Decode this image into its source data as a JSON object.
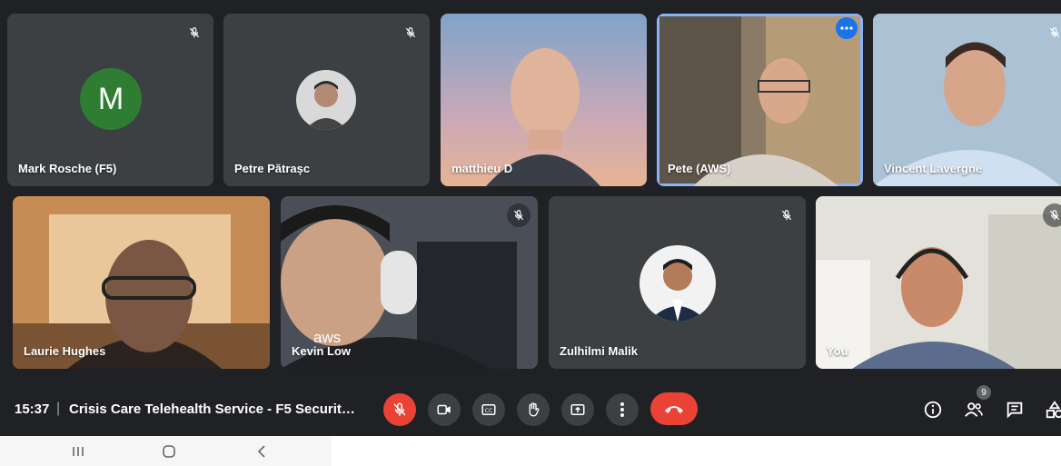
{
  "participants": [
    {
      "name": "Mark Rosche (F5)",
      "avatar_letter": "M",
      "avatar_color": "#2e7d32",
      "muted": true
    },
    {
      "name": "Petre Pătrașc",
      "muted": true
    },
    {
      "name": "matthieu D",
      "muted": false
    },
    {
      "name": "Pete (AWS)",
      "muted": false,
      "active_speaker": true
    },
    {
      "name": "Vincent Lavergne",
      "muted": true
    },
    {
      "name": "Laurie Hughes",
      "muted": false
    },
    {
      "name": "Kevin Low",
      "muted": true
    },
    {
      "name": "Zulhilmi Malik",
      "muted": true
    },
    {
      "name": "You",
      "muted": true
    }
  ],
  "overlay_text": {
    "kevin_hoodie_logo": "aws"
  },
  "toolbar": {
    "time": "15:37",
    "separator": "|",
    "meeting_title": "Crisis Care Telehealth Service - F5 Securit…",
    "people_count": "9",
    "controls": [
      "mic-off-icon",
      "camera-icon",
      "captions-icon",
      "raise-hand-icon",
      "present-icon",
      "more-vert-icon",
      "end-call-icon"
    ],
    "right_icons": [
      "info-icon",
      "people-icon",
      "chat-icon",
      "activities-icon"
    ]
  },
  "android_nav": [
    "recents-icon",
    "home-icon",
    "back-icon"
  ],
  "colors": {
    "background": "#202124",
    "tile": "#3c4043",
    "danger": "#ea4335",
    "accent": "#1a73e8"
  }
}
